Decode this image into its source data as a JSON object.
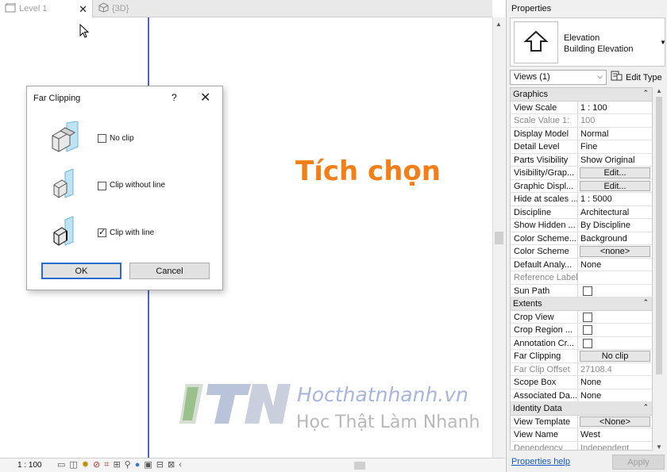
{
  "tabs": [
    {
      "label": "Level 1",
      "active": true
    },
    {
      "label": "{3D}",
      "active": false
    }
  ],
  "annotation": "Tích chọn",
  "watermark": {
    "site": "Hocthatnhanh.vn",
    "slogan": "Học Thật  Làm Nhanh"
  },
  "dialog": {
    "title": "Far Clipping",
    "help": "?",
    "options": [
      {
        "label": "No clip",
        "checked": false
      },
      {
        "label": "Clip without line",
        "checked": false
      },
      {
        "label": "Clip with line",
        "checked": true
      }
    ],
    "ok_label": "OK",
    "cancel_label": "Cancel"
  },
  "status": {
    "scale": "1 : 100"
  },
  "properties": {
    "title": "Properties",
    "type_line1": "Elevation",
    "type_line2": "Building Elevation",
    "views_select": "Views (1)",
    "edit_type": "Edit Type",
    "groups": {
      "graphics": "Graphics",
      "extents": "Extents",
      "identity": "Identity Data"
    },
    "rows": {
      "view_scale": {
        "k": "View Scale",
        "v": "1 : 100"
      },
      "scale_value": {
        "k": "Scale Value   1:",
        "v": "100"
      },
      "display_model": {
        "k": "Display Model",
        "v": "Normal"
      },
      "detail_level": {
        "k": "Detail Level",
        "v": "Fine"
      },
      "parts_visibility": {
        "k": "Parts Visibility",
        "v": "Show Original"
      },
      "vis_graphics": {
        "k": "Visibility/Grap...",
        "v": "Edit..."
      },
      "graphic_display": {
        "k": "Graphic Displ...",
        "v": "Edit..."
      },
      "hide_at_scales": {
        "k": "Hide at scales ...",
        "v": "1 : 5000"
      },
      "discipline": {
        "k": "Discipline",
        "v": "Architectural"
      },
      "show_hidden": {
        "k": "Show Hidden ...",
        "v": "By Discipline"
      },
      "color_scheme_loc": {
        "k": "Color Scheme...",
        "v": "Background"
      },
      "color_scheme": {
        "k": "Color Scheme",
        "v": "<none>"
      },
      "default_analysis": {
        "k": "Default Analy...",
        "v": "None"
      },
      "reference_label": {
        "k": "Reference Label",
        "v": ""
      },
      "sun_path": {
        "k": "Sun Path",
        "v": ""
      },
      "crop_view": {
        "k": "Crop View",
        "v": ""
      },
      "crop_region": {
        "k": "Crop Region ...",
        "v": ""
      },
      "annotation_crop": {
        "k": "Annotation Cr...",
        "v": ""
      },
      "far_clipping": {
        "k": "Far Clipping",
        "v": "No clip"
      },
      "far_clip_offset": {
        "k": "Far Clip Offset",
        "v": "27108.4"
      },
      "scope_box": {
        "k": "Scope Box",
        "v": "None"
      },
      "associated_datum": {
        "k": "Associated Da...",
        "v": "None"
      },
      "view_template": {
        "k": "View Template",
        "v": "<None>"
      },
      "view_name": {
        "k": "View Name",
        "v": "West"
      },
      "dependency": {
        "k": "Dependency",
        "v": "Independent"
      }
    },
    "help_link": "Properties help",
    "apply_label": "Apply"
  },
  "colors": {
    "accent_orange": "#f57f17",
    "view_line": "#4a67c9",
    "link_blue": "#1a57c4"
  }
}
